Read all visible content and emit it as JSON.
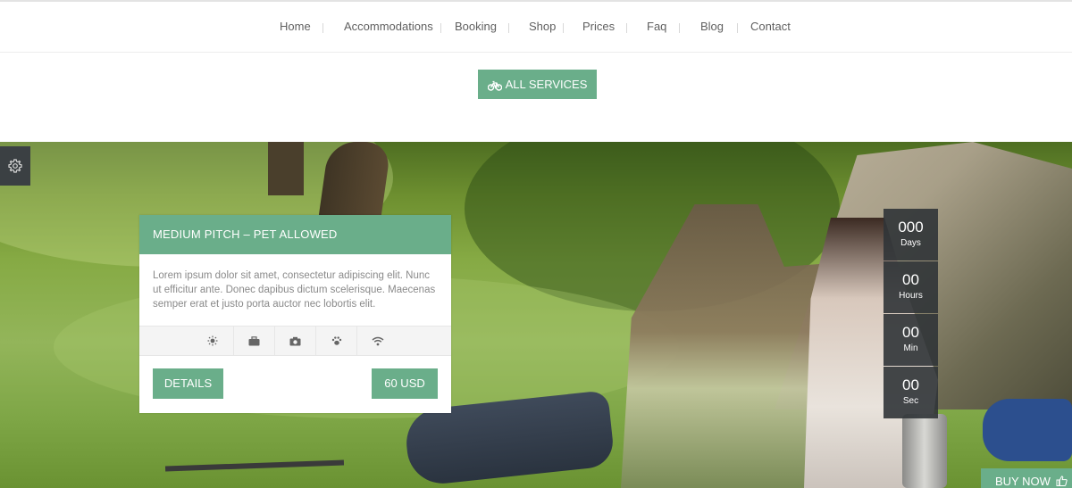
{
  "nav": {
    "items": [
      "Home",
      "Accommodations",
      "Booking",
      "Shop",
      "Prices",
      "Faq",
      "Blog",
      "Contact"
    ]
  },
  "services_button": {
    "label": "ALL SERVICES",
    "icon": "bicycle-icon"
  },
  "settings": {
    "icon": "gear-icon"
  },
  "card": {
    "title": "MEDIUM PITCH – PET ALLOWED",
    "description": "Lorem ipsum dolor sit amet, consectetur adipiscing elit. Nunc ut efficitur ante. Donec dapibus dictum scelerisque. Maecenas semper erat et justo porta auctor nec lobortis elit.",
    "amenities": [
      "sun-icon",
      "suitcase-icon",
      "camera-icon",
      "paw-icon",
      "wifi-icon"
    ],
    "details_label": "DETAILS",
    "price_label": "60 USD"
  },
  "countdown": [
    {
      "value": "000",
      "label": "Days"
    },
    {
      "value": "00",
      "label": "Hours"
    },
    {
      "value": "00",
      "label": "Min"
    },
    {
      "value": "00",
      "label": "Sec"
    }
  ],
  "buy_now": {
    "label": "BUY NOW",
    "icon": "thumbs-up-icon"
  },
  "colors": {
    "accent": "#6aae8a",
    "dark": "#3b4043"
  }
}
